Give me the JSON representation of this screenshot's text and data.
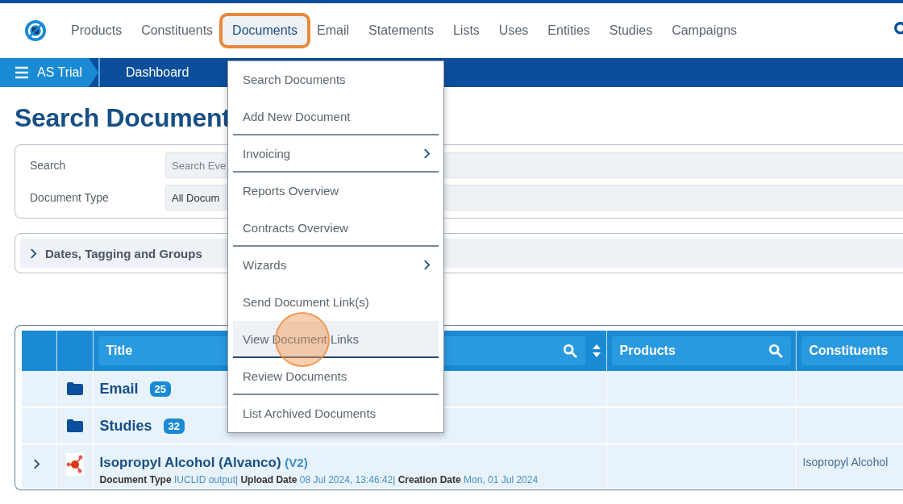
{
  "nav": {
    "items": [
      {
        "label": "Products",
        "selected": false
      },
      {
        "label": "Constituents",
        "selected": false
      },
      {
        "label": "Documents",
        "selected": true
      },
      {
        "label": "Email",
        "selected": false
      },
      {
        "label": "Statements",
        "selected": false
      },
      {
        "label": "Lists",
        "selected": false
      },
      {
        "label": "Uses",
        "selected": false
      },
      {
        "label": "Entities",
        "selected": false
      },
      {
        "label": "Studies",
        "selected": false
      },
      {
        "label": "Campaigns",
        "selected": false
      }
    ]
  },
  "breadcrumb": [
    {
      "label": "AS Trial",
      "kind": "home"
    },
    {
      "label": "Dashboard",
      "kind": "crumb"
    }
  ],
  "page_title": "Search Document",
  "search_form": {
    "fields": [
      {
        "label": "Search",
        "kind": "text",
        "placeholder": "Search Eve"
      },
      {
        "label": "Document Type",
        "kind": "select",
        "value": "All Docum"
      }
    ]
  },
  "filters": {
    "label": "Dates, Tagging and Groups",
    "expanded": false
  },
  "table": {
    "columns": [
      {
        "label": "Title",
        "searchable": true,
        "sortable": true
      },
      {
        "label": "Products",
        "searchable": true,
        "sortable": false
      },
      {
        "label": "Constituents"
      }
    ],
    "rows": [
      {
        "kind": "folder",
        "title": "Email",
        "count": "25"
      },
      {
        "kind": "folder",
        "title": "Studies",
        "count": "32"
      },
      {
        "kind": "document",
        "expanded": false,
        "title": "Isopropyl Alcohol (Alvanco)",
        "version": "(V2)",
        "meta": "**Document Type** IUCLID output| **Upload Date** 08 Jul 2024, 13:46:42| **Creation Date** Mon, 01 Jul 2024",
        "constituents": "Isopropyl Alcohol"
      }
    ]
  },
  "menu": {
    "items": [
      {
        "label": "Search Documents",
        "hovered": false,
        "has_submenu": false,
        "separator_after": false
      },
      {
        "label": "Add New Document",
        "hovered": false,
        "has_submenu": false,
        "separator_after": true
      },
      {
        "label": "Invoicing",
        "hovered": false,
        "has_submenu": true,
        "separator_after": true
      },
      {
        "label": "Reports Overview",
        "hovered": false,
        "has_submenu": false,
        "separator_after": false
      },
      {
        "label": "Contracts Overview",
        "hovered": false,
        "has_submenu": false,
        "separator_after": true
      },
      {
        "label": "Wizards",
        "hovered": false,
        "has_submenu": true,
        "separator_after": false
      },
      {
        "label": "Send Document Link(s)",
        "hovered": false,
        "has_submenu": false,
        "separator_after": false
      },
      {
        "label": "View Document Links",
        "hovered": true,
        "has_submenu": false,
        "separator_after": true
      },
      {
        "label": "Review Documents",
        "hovered": false,
        "has_submenu": false,
        "separator_after": true
      },
      {
        "label": "List Archived Documents",
        "hovered": false,
        "has_submenu": false,
        "separator_after": false
      }
    ]
  }
}
